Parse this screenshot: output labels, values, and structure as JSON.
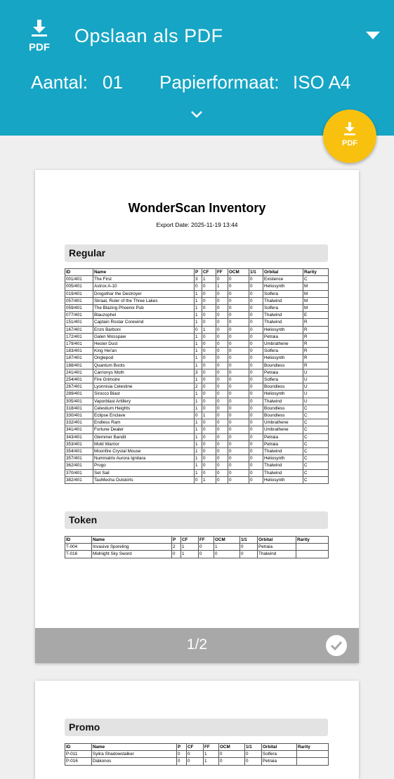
{
  "header": {
    "title": "Opslaan als PDF",
    "copies_label": "Aantal:",
    "copies_value": "01",
    "paper_label": "Papierformaat:",
    "paper_value": "ISO A4",
    "pdf_icon_text": "PDF",
    "fab_icon_text": "PDF"
  },
  "preview": {
    "doc_title": "WonderScan Inventory",
    "export_date": "Export Date: 2025-11-19 13:44",
    "page_indicator": "1/2",
    "columns_regular": [
      "ID",
      "Name",
      "P",
      "CF",
      "FF",
      "OCM",
      "1/1",
      "Orbital",
      "Rarity"
    ],
    "sections": {
      "regular": {
        "title": "Regular",
        "rows": [
          [
            "001/401",
            "The First",
            "3",
            "1",
            "0",
            "0",
            "0",
            "Existence",
            "C"
          ],
          [
            "005/401",
            "Astrox A-10",
            "0",
            "0",
            "1",
            "0",
            "0",
            "Heliosynth",
            "M"
          ],
          [
            "019/401",
            "Drogothar the Destroyer",
            "1",
            "0",
            "0",
            "0",
            "0",
            "Solfera",
            "M"
          ],
          [
            "057/401",
            "Skraal, Ruler of the Three Lakes",
            "1",
            "0",
            "0",
            "0",
            "0",
            "Thalwind",
            "M"
          ],
          [
            "059/401",
            "The Blazing Phoenix Pub",
            "1",
            "0",
            "0",
            "0",
            "0",
            "Solfera",
            "M"
          ],
          [
            "077/401",
            "Blauzophel",
            "1",
            "0",
            "0",
            "0",
            "0",
            "Thalwind",
            "E"
          ],
          [
            "151/401",
            "Captain Rostar Corewind",
            "1",
            "0",
            "0",
            "0",
            "0",
            "Thalwind",
            "R"
          ],
          [
            "167/401",
            "Enzo Barboni",
            "0",
            "1",
            "0",
            "0",
            "0",
            "Heliosynth",
            "R"
          ],
          [
            "172/401",
            "Galen Mosspaw",
            "1",
            "0",
            "0",
            "0",
            "0",
            "Petraia",
            "R"
          ],
          [
            "179/401",
            "Hester Dust",
            "1",
            "0",
            "0",
            "0",
            "0",
            "Umbrathene",
            "R"
          ],
          [
            "183/401",
            "King Hei'an",
            "1",
            "0",
            "0",
            "0",
            "0",
            "Solfera",
            "R"
          ],
          [
            "187/401",
            "Onglepod",
            "1",
            "0",
            "0",
            "0",
            "0",
            "Heliosynth",
            "R"
          ],
          [
            "188/401",
            "Quantum Boots",
            "1",
            "0",
            "0",
            "0",
            "0",
            "Boundless",
            "R"
          ],
          [
            "241/401",
            "Carrionys Moth",
            "3",
            "0",
            "0",
            "0",
            "0",
            "Petraia",
            "U"
          ],
          [
            "254/401",
            "Fire Grimoire",
            "1",
            "0",
            "0",
            "0",
            "0",
            "Solfera",
            "U"
          ],
          [
            "267/401",
            "Lyonnisia Celestine",
            "2",
            "0",
            "0",
            "0",
            "0",
            "Boundless",
            "U"
          ],
          [
            "289/401",
            "Sirocco Blast",
            "1",
            "0",
            "0",
            "0",
            "0",
            "Heliosynth",
            "U"
          ],
          [
            "305/401",
            "Vaporblast Artillery",
            "1",
            "0",
            "0",
            "0",
            "0",
            "Thalwind",
            "U"
          ],
          [
            "318/401",
            "Celestium Heights",
            "1",
            "0",
            "0",
            "0",
            "0",
            "Boundless",
            "C"
          ],
          [
            "330/401",
            "Eclipse Enclave",
            "0",
            "1",
            "0",
            "0",
            "0",
            "Boundless",
            "C"
          ],
          [
            "332/401",
            "Endless Ram",
            "1",
            "0",
            "0",
            "0",
            "0",
            "Umbrathene",
            "C"
          ],
          [
            "341/401",
            "Fortune Dealer",
            "1",
            "0",
            "0",
            "0",
            "0",
            "Umbrathene",
            "C"
          ],
          [
            "343/401",
            "Glemmer Bandit",
            "1",
            "0",
            "0",
            "0",
            "0",
            "Petraia",
            "C"
          ],
          [
            "353/401",
            "Mold Warrior",
            "1",
            "0",
            "0",
            "0",
            "0",
            "Petraia",
            "C"
          ],
          [
            "354/401",
            "Moonfire Crystal Mouse",
            "1",
            "0",
            "0",
            "0",
            "0",
            "Thalwind",
            "C"
          ],
          [
            "357/401",
            "Numinatrix Aurora Ignitara",
            "1",
            "0",
            "0",
            "0",
            "0",
            "Heliosynth",
            "C"
          ],
          [
            "362/401",
            "Progo",
            "1",
            "0",
            "0",
            "0",
            "0",
            "Thalwind",
            "C"
          ],
          [
            "370/401",
            "Set Sail",
            "1",
            "0",
            "0",
            "0",
            "0",
            "Thalwind",
            "C"
          ],
          [
            "382/401",
            "TauMecha Outskirts",
            "0",
            "1",
            "0",
            "0",
            "0",
            "Heliosynth",
            "C"
          ]
        ]
      },
      "token": {
        "title": "Token",
        "rows": [
          [
            "T-004",
            "Invasive Sporeling",
            "2",
            "1",
            "0",
            "1",
            "0",
            "Petraia",
            ""
          ],
          [
            "T-016",
            "Midnight Sky Sword",
            "0",
            "1",
            "0",
            "0",
            "0",
            "Thalwind",
            ""
          ]
        ]
      },
      "promo": {
        "title": "Promo",
        "rows": [
          [
            "P-011",
            "Sylira Shadowstalker",
            "0",
            "0",
            "1",
            "0",
            "0",
            "Solfera",
            ""
          ],
          [
            "P-016",
            "Diákonos",
            "0",
            "0",
            "1",
            "0",
            "0",
            "Petraia",
            ""
          ]
        ]
      }
    }
  },
  "colors": {
    "header": "#16a5c4",
    "fab": "#f9c10f",
    "footer": "#a8a8a8"
  }
}
